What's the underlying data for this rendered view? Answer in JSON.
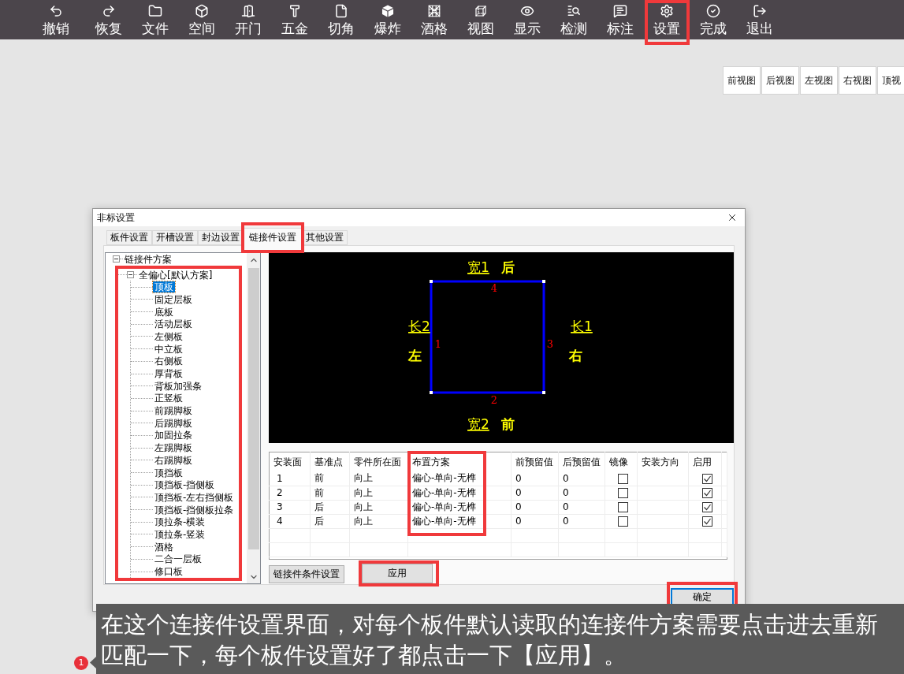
{
  "toolbar": {
    "items": [
      {
        "label": "撤销",
        "highlighted": false
      },
      {
        "label": "恢复",
        "highlighted": false
      },
      {
        "label": "文件",
        "highlighted": false
      },
      {
        "label": "空间",
        "highlighted": false
      },
      {
        "label": "开门",
        "highlighted": false
      },
      {
        "label": "五金",
        "highlighted": false
      },
      {
        "label": "切角",
        "highlighted": false
      },
      {
        "label": "爆炸",
        "highlighted": false
      },
      {
        "label": "酒格",
        "highlighted": false
      },
      {
        "label": "视图",
        "highlighted": false
      },
      {
        "label": "显示",
        "highlighted": false
      },
      {
        "label": "检测",
        "highlighted": false
      },
      {
        "label": "标注",
        "highlighted": false
      },
      {
        "label": "设置",
        "highlighted": true
      },
      {
        "label": "完成",
        "highlighted": false
      },
      {
        "label": "退出",
        "highlighted": false
      }
    ]
  },
  "view_buttons": [
    "前视图",
    "后视图",
    "左视图",
    "右视图",
    "顶视"
  ],
  "dialog": {
    "title": "非标设置",
    "tabs": [
      {
        "label": "板件设置",
        "selected": false,
        "highlighted": false
      },
      {
        "label": "开槽设置",
        "selected": false,
        "highlighted": false
      },
      {
        "label": "封边设置",
        "selected": false,
        "highlighted": false
      },
      {
        "label": "链接件设置",
        "selected": true,
        "highlighted": true
      },
      {
        "label": "其他设置",
        "selected": false,
        "highlighted": false
      }
    ],
    "tree": {
      "label": "链接件方案",
      "selected": false,
      "expanded": true,
      "children": [
        {
          "label": "全偏心[默认方案]",
          "selected": false,
          "expanded": true,
          "highlighted": true,
          "children": [
            {
              "label": "顶板",
              "selected": true
            },
            {
              "label": "固定层板",
              "selected": false
            },
            {
              "label": "底板",
              "selected": false
            },
            {
              "label": "活动层板",
              "selected": false
            },
            {
              "label": "左侧板",
              "selected": false
            },
            {
              "label": "中立板",
              "selected": false
            },
            {
              "label": "右侧板",
              "selected": false
            },
            {
              "label": "厚背板",
              "selected": false
            },
            {
              "label": "背板加强条",
              "selected": false
            },
            {
              "label": "正竖板",
              "selected": false
            },
            {
              "label": "前踢脚板",
              "selected": false
            },
            {
              "label": "后踢脚板",
              "selected": false
            },
            {
              "label": "加固拉条",
              "selected": false
            },
            {
              "label": "左踢脚板",
              "selected": false
            },
            {
              "label": "右踢脚板",
              "selected": false
            },
            {
              "label": "顶挡板",
              "selected": false
            },
            {
              "label": "顶挡板-挡侧板",
              "selected": false
            },
            {
              "label": "顶挡板-左右挡侧板",
              "selected": false
            },
            {
              "label": "顶挡板-挡侧板拉条",
              "selected": false
            },
            {
              "label": "顶拉条-横装",
              "selected": false
            },
            {
              "label": "顶拉条-竖装",
              "selected": false
            },
            {
              "label": "酒格",
              "selected": false
            },
            {
              "label": "二合一层板",
              "selected": false
            },
            {
              "label": "修口板",
              "selected": false
            }
          ]
        }
      ]
    },
    "diagram": {
      "top": {
        "dimension": "宽1",
        "side": "后",
        "number": "4"
      },
      "left": {
        "dimension": "长2",
        "side": "左",
        "number": "1"
      },
      "right": {
        "dimension": "长1",
        "side": "右",
        "number": "3"
      },
      "bottom": {
        "dimension": "宽2",
        "side": "前",
        "number": "2"
      }
    },
    "table": {
      "columns": [
        {
          "label": "安装面",
          "highlighted": false
        },
        {
          "label": "基准点",
          "highlighted": false
        },
        {
          "label": "零件所在面",
          "highlighted": false
        },
        {
          "label": "布置方案",
          "highlighted": true
        },
        {
          "label": "前预留值",
          "highlighted": false
        },
        {
          "label": "后预留值",
          "highlighted": false
        },
        {
          "label": "镜像",
          "highlighted": false
        },
        {
          "label": "安装方向",
          "highlighted": false
        },
        {
          "label": "启用",
          "highlighted": false
        }
      ],
      "rows": [
        {
          "face": "1",
          "base_point": "前",
          "part_face": "向上",
          "scheme": "偏心-单向-无榫",
          "front_reserve": "0",
          "back_reserve": "0",
          "mirror": false,
          "enabled": true
        },
        {
          "face": "2",
          "base_point": "前",
          "part_face": "向上",
          "scheme": "偏心-单向-无榫",
          "front_reserve": "0",
          "back_reserve": "0",
          "mirror": false,
          "enabled": true
        },
        {
          "face": "3",
          "base_point": "后",
          "part_face": "向上",
          "scheme": "偏心-单向-无榫",
          "front_reserve": "0",
          "back_reserve": "0",
          "mirror": false,
          "enabled": true
        },
        {
          "face": "4",
          "base_point": "后",
          "part_face": "向上",
          "scheme": "偏心-单向-无榫",
          "front_reserve": "0",
          "back_reserve": "0",
          "mirror": false,
          "enabled": true
        }
      ]
    },
    "buttons": [
      {
        "label": "链接件条件设置",
        "highlighted": false
      },
      {
        "label": "应用",
        "highlighted": true
      }
    ],
    "ok_button": {
      "label": "确定",
      "highlighted": true
    }
  },
  "caption": {
    "badge": "1",
    "text": "在这个连接件设置界面，对每个板件默认读取的连接件方案需要点击进去重新匹配一下，每个板件设置好了都点击一下【应用】。"
  }
}
